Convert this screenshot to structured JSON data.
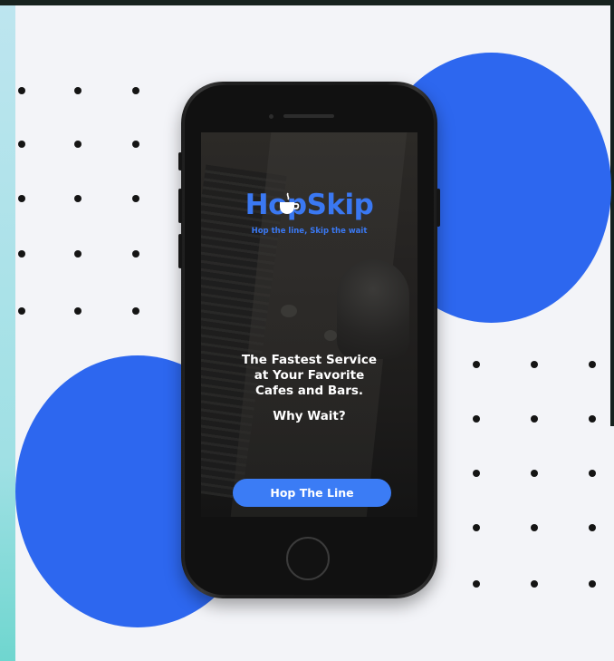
{
  "app": {
    "logo_text": "HopSkip",
    "tagline": "Hop the line, Skip the wait",
    "headline": "The Fastest Service\nat Your Favorite\nCafes and Bars.",
    "subheadline": "Why Wait?",
    "cta_label": "Hop The Line"
  },
  "colors": {
    "accent": "#2d67ef",
    "button": "#3b7cf5",
    "logo": "#3a78f2",
    "page_background": "#f3f4f8",
    "dots": "#141414",
    "phone_body": "#1a1a1a"
  },
  "icons": [
    "coffee-cup-icon"
  ]
}
